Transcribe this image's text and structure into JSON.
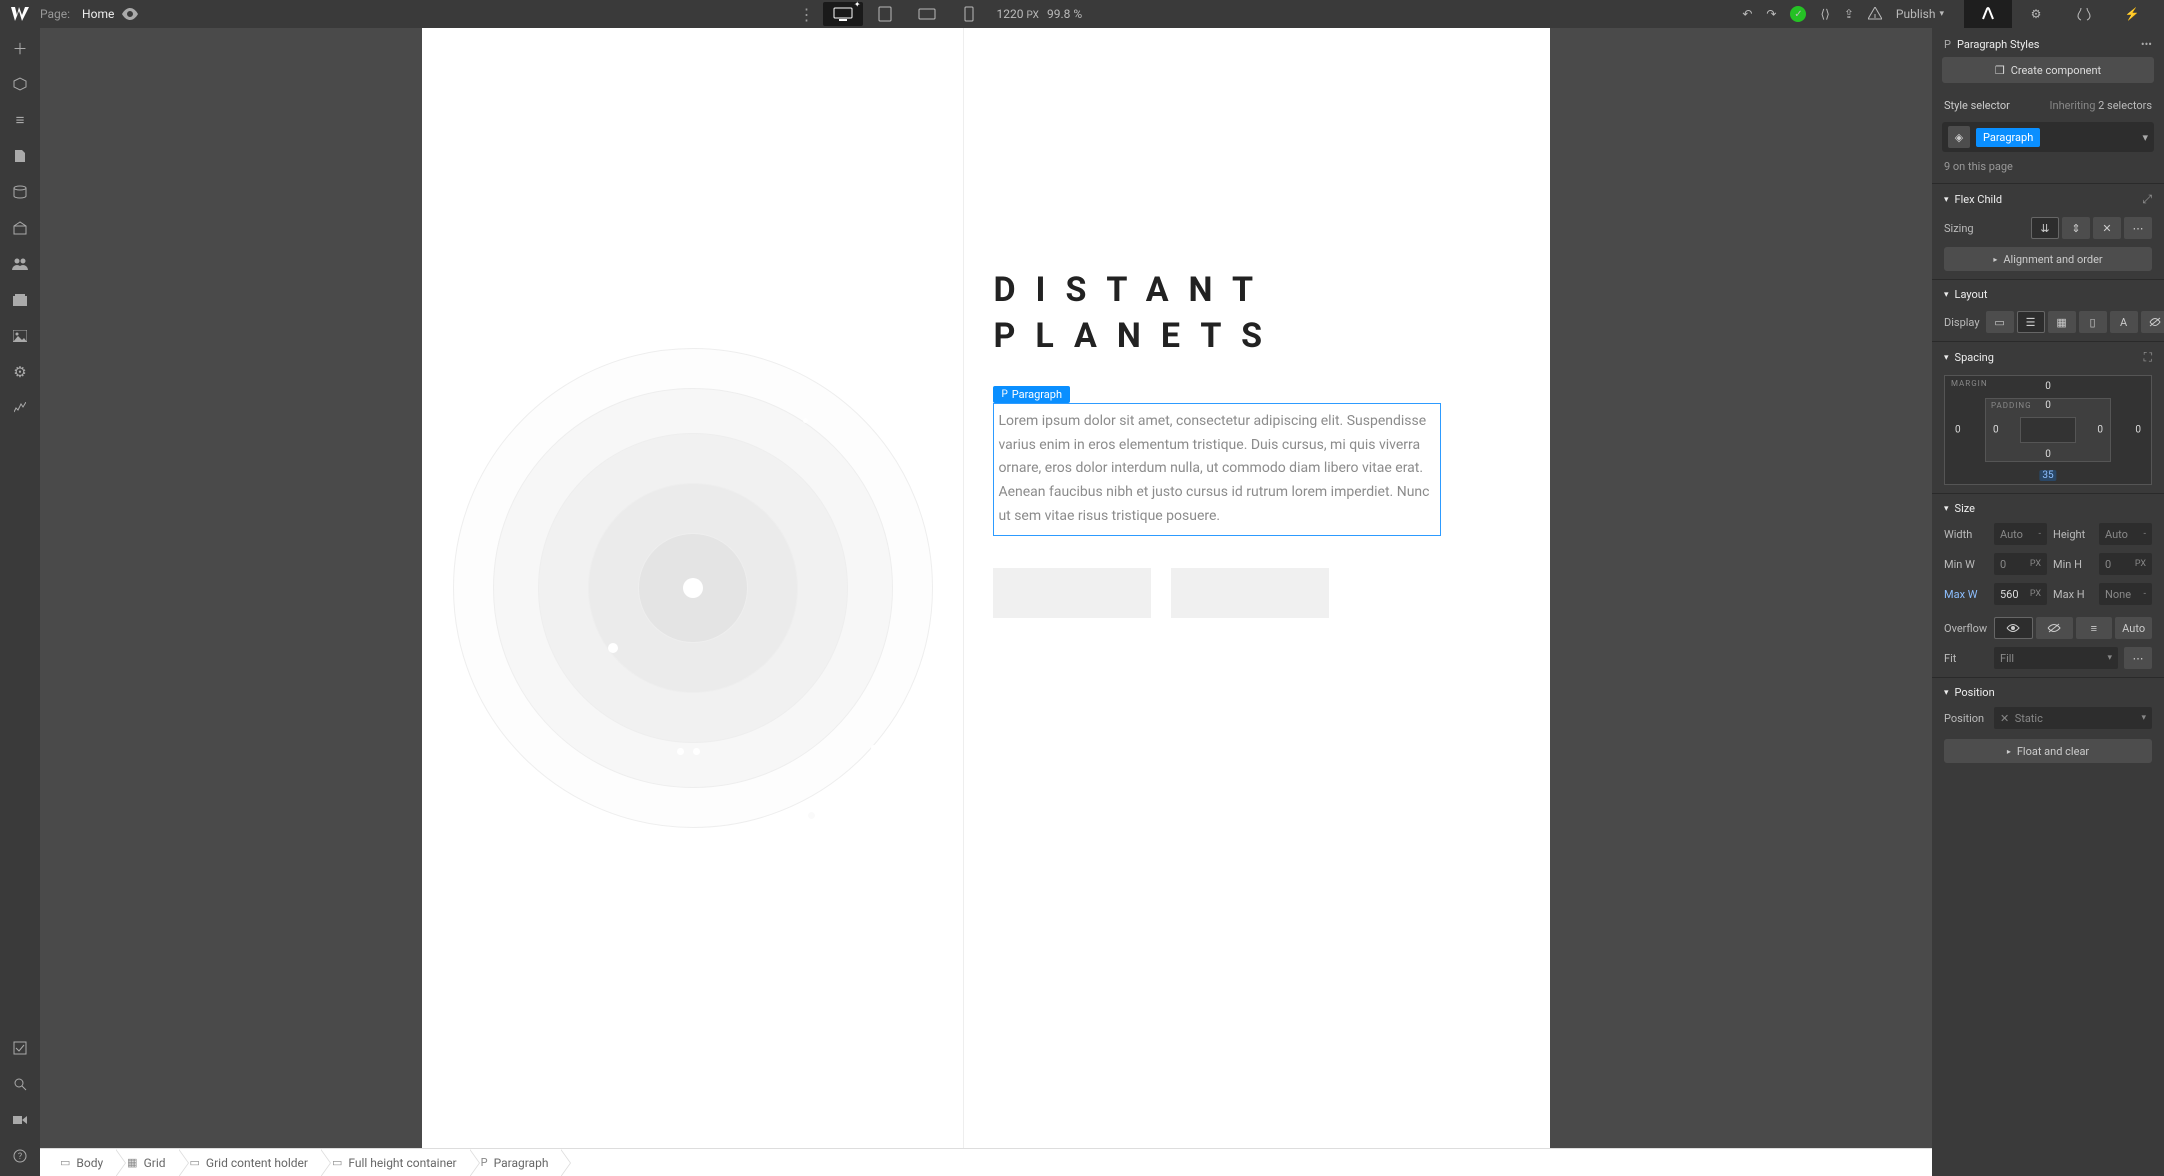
{
  "topbar": {
    "page_prefix": "Page:",
    "page_name": "Home",
    "viewport_px": "1220",
    "viewport_unit": "PX",
    "zoom": "99.8",
    "zoom_unit": "%",
    "publish_label": "Publish"
  },
  "canvas": {
    "heading_line1": "DISTANT",
    "heading_line2": "PLANETS",
    "selection_tag": "Paragraph",
    "paragraph_text": "Lorem ipsum dolor sit amet, consectetur adipiscing elit. Suspendisse varius enim in eros elementum tristique. Duis cursus, mi quis viverra ornare, eros dolor interdum nulla, ut commodo diam libero vitae erat. Aenean faucibus nibh et justo cursus id rutrum lorem imperdiet. Nunc ut sem vitae risus tristique posuere."
  },
  "breadcrumb": [
    {
      "icon": "▭",
      "label": "Body"
    },
    {
      "icon": "▦",
      "label": "Grid"
    },
    {
      "icon": "▭",
      "label": "Grid content holder"
    },
    {
      "icon": "▭",
      "label": "Full height container"
    },
    {
      "icon": "P",
      "label": "Paragraph"
    }
  ],
  "panel": {
    "header": "Paragraph Styles",
    "create_component": "Create component",
    "style_selector_label": "Style selector",
    "inheriting_prefix": "Inheriting",
    "inheriting_count": "2 selectors",
    "selector_tag": "Paragraph",
    "on_page": "9 on this page",
    "sections": {
      "flex_child": "Flex Child",
      "sizing_label": "Sizing",
      "align_order": "Alignment and order",
      "layout": "Layout",
      "display_label": "Display",
      "spacing": "Spacing",
      "margin_label": "MARGIN",
      "padding_label": "PADDING",
      "margin": {
        "top": "0",
        "right": "0",
        "bottom": "35",
        "left": "0"
      },
      "padding": {
        "top": "0",
        "right": "0",
        "bottom": "0",
        "left": "0"
      },
      "size": "Size",
      "width_label": "Width",
      "width_val": "Auto",
      "height_label": "Height",
      "height_val": "Auto",
      "minw_label": "Min W",
      "minw_val": "0",
      "minw_unit": "PX",
      "minh_label": "Min H",
      "minh_val": "0",
      "minh_unit": "PX",
      "maxw_label": "Max W",
      "maxw_val": "560",
      "maxw_unit": "PX",
      "maxh_label": "Max H",
      "maxh_val": "None",
      "overflow_label": "Overflow",
      "overflow_auto": "Auto",
      "fit_label": "Fit",
      "fit_val": "Fill",
      "position": "Position",
      "position_label": "Position",
      "position_val": "Static",
      "float_clear": "Float and clear"
    }
  }
}
